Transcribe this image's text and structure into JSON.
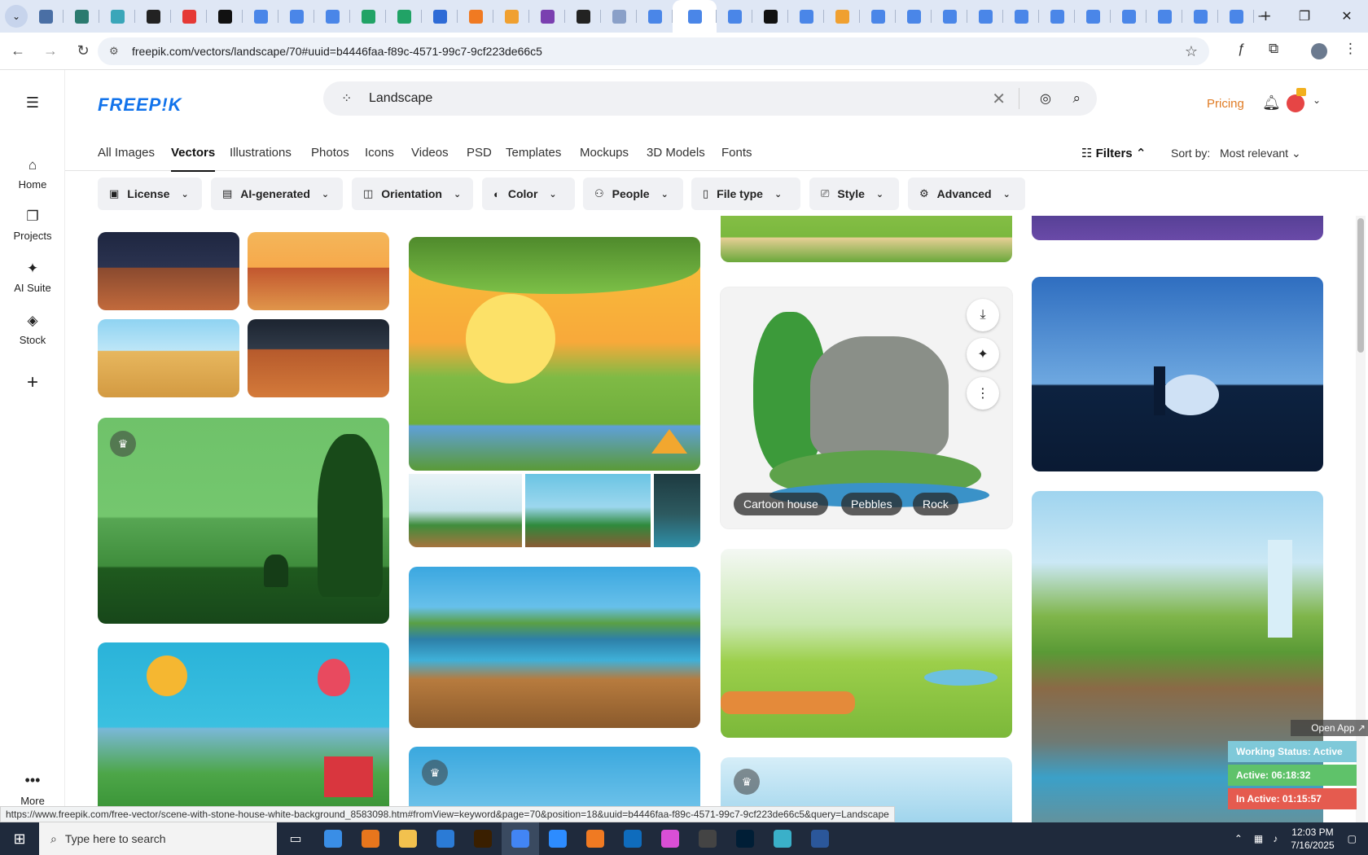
{
  "browser": {
    "url": "freepik.com/vectors/landscape/70#uuid=b4446faa-f89c-4571-99c7-9cf223de66c5",
    "tab_favicon_colors": [
      "#4a6fa5",
      "#2b7a6f",
      "#3aa6b9",
      "#222222",
      "#e53935",
      "#111111",
      "#4a86e8",
      "#4a86e8",
      "#4a86e8",
      "#21a366",
      "#21a366",
      "#2e6bd6",
      "#f07a22",
      "#f0a030",
      "#7a3fb0",
      "#222222",
      "#8aa0c8",
      "#4a86e8",
      "#4a86e8",
      "#4a86e8",
      "#111111",
      "#4a86e8",
      "#f0a030",
      "#4a86e8",
      "#4a86e8",
      "#4a86e8",
      "#4a86e8",
      "#4a86e8",
      "#4a86e8",
      "#4a86e8",
      "#4a86e8",
      "#4a86e8",
      "#4a86e8",
      "#4a86e8"
    ],
    "status_url": "https://www.freepik.com/free-vector/scene-with-stone-house-white-background_8583098.htm#fromView=keyword&page=70&position=18&uuid=b4446faa-f89c-4571-99c7-9cf223de66c5&query=Landscape"
  },
  "sidebar": {
    "items": [
      {
        "label": "Home",
        "icon": "home-icon",
        "glyph": "⌂"
      },
      {
        "label": "Projects",
        "icon": "folder-icon",
        "glyph": "❐"
      },
      {
        "label": "AI Suite",
        "icon": "sparkle-icon",
        "glyph": "✦"
      },
      {
        "label": "Stock",
        "icon": "stock-icon",
        "glyph": "◈"
      }
    ],
    "add_glyph": "+",
    "more_label": "More"
  },
  "header": {
    "logo": "FREEP!K",
    "search_value": "Landscape",
    "pricing": "Pricing"
  },
  "categories": [
    {
      "label": "All Images",
      "selected": false
    },
    {
      "label": "Vectors",
      "selected": true
    },
    {
      "label": "Illustrations",
      "selected": false
    },
    {
      "label": "Photos",
      "selected": false
    },
    {
      "label": "Icons",
      "selected": false
    },
    {
      "label": "Videos",
      "selected": false
    },
    {
      "label": "PSD",
      "selected": false
    },
    {
      "label": "Templates",
      "selected": false
    },
    {
      "label": "Mockups",
      "selected": false
    },
    {
      "label": "3D Models",
      "selected": false
    },
    {
      "label": "Fonts",
      "selected": false
    }
  ],
  "filters": {
    "label": "Filters",
    "sort_label": "Sort by:",
    "sort_value": "Most relevant"
  },
  "chips": [
    {
      "label": "License",
      "icon": "license-icon"
    },
    {
      "label": "AI-generated",
      "icon": "ai-generated-icon"
    },
    {
      "label": "Orientation",
      "icon": "orientation-icon"
    },
    {
      "label": "Color",
      "icon": "palette-icon"
    },
    {
      "label": "People",
      "icon": "people-icon"
    },
    {
      "label": "File type",
      "icon": "file-icon"
    },
    {
      "label": "Style",
      "icon": "brush-icon"
    },
    {
      "label": "Advanced",
      "icon": "gear-icon"
    }
  ],
  "hover_card": {
    "tags": [
      "Cartoon house",
      "Pebbles",
      "Rock"
    ]
  },
  "tracker": {
    "open_app": "Open App ↗",
    "working_status": "Working Status: Active",
    "active": "Active: 06:18:32",
    "inactive": "In Active: 01:15:57"
  },
  "taskbar": {
    "search_placeholder": "Type here to search",
    "time": "12:03 PM",
    "date": "7/16/2025",
    "app_colors": [
      "#3a8ee6",
      "#e8761d",
      "#f2c14e",
      "#2b7bd6",
      "#3a1f00",
      "#4285f4",
      "#2d8cff",
      "#f07a22",
      "#0f6cbd",
      "#d94fd6",
      "#444444",
      "#001e36",
      "#3ab0c9",
      "#2b579a"
    ]
  }
}
